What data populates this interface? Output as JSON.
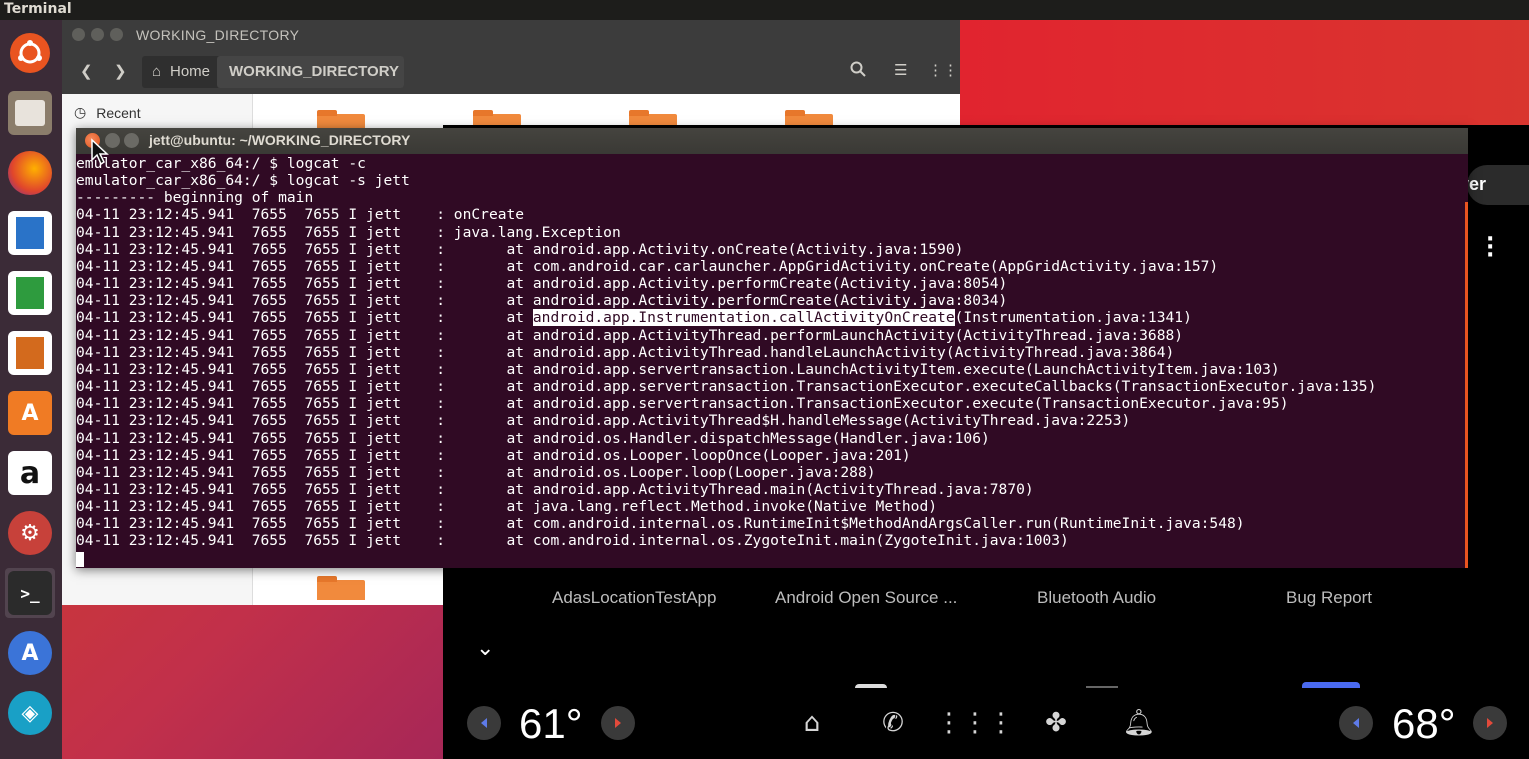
{
  "top_panel": {
    "app_name": "Terminal"
  },
  "launcher": {
    "items": [
      "ubuntu-dash",
      "files",
      "firefox",
      "libreoffice-writer",
      "libreoffice-calc",
      "libreoffice-impress",
      "ubuntu-software",
      "amazon",
      "system-settings",
      "terminal",
      "android-studio",
      "remote-app"
    ]
  },
  "nautilus": {
    "title": "WORKING_DIRECTORY",
    "path_home": "Home",
    "path_current": "WORKING_DIRECTORY",
    "sidebar_recent": "Recent"
  },
  "terminal": {
    "title": "jett@ubuntu: ~/WORKING_DIRECTORY",
    "prefix_lines": [
      "emulator_car_x86_64:/ $ logcat -c",
      "emulator_car_x86_64:/ $ logcat -s jett",
      "--------- beginning of main",
      "04-11 23:12:45.941  7655  7655 I jett    : onCreate",
      "04-11 23:12:45.941  7655  7655 I jett    : java.lang.Exception",
      "04-11 23:12:45.941  7655  7655 I jett    :       at android.app.Activity.onCreate(Activity.java:1590)",
      "04-11 23:12:45.941  7655  7655 I jett    :       at com.android.car.carlauncher.AppGridActivity.onCreate(AppGridActivity.java:157)",
      "04-11 23:12:45.941  7655  7655 I jett    :       at android.app.Activity.performCreate(Activity.java:8054)",
      "04-11 23:12:45.941  7655  7655 I jett    :       at android.app.Activity.performCreate(Activity.java:8034)"
    ],
    "hl_line_before": "04-11 23:12:45.941  7655  7655 I jett    :       at ",
    "hl_text": "android.app.Instrumentation.callActivityOnCreate",
    "hl_line_after": "(Instrumentation.java:1341)",
    "suffix_lines": [
      "04-11 23:12:45.941  7655  7655 I jett    :       at android.app.ActivityThread.performLaunchActivity(ActivityThread.java:3688)",
      "04-11 23:12:45.941  7655  7655 I jett    :       at android.app.ActivityThread.handleLaunchActivity(ActivityThread.java:3864)",
      "04-11 23:12:45.941  7655  7655 I jett    :       at android.app.servertransaction.LaunchActivityItem.execute(LaunchActivityItem.java:103)",
      "04-11 23:12:45.941  7655  7655 I jett    :       at android.app.servertransaction.TransactionExecutor.executeCallbacks(TransactionExecutor.java:135)",
      "04-11 23:12:45.941  7655  7655 I jett    :       at android.app.servertransaction.TransactionExecutor.execute(TransactionExecutor.java:95)",
      "04-11 23:12:45.941  7655  7655 I jett    :       at android.app.ActivityThread$H.handleMessage(ActivityThread.java:2253)",
      "04-11 23:12:45.941  7655  7655 I jett    :       at android.os.Handler.dispatchMessage(Handler.java:106)",
      "04-11 23:12:45.941  7655  7655 I jett    :       at android.os.Looper.loopOnce(Looper.java:201)",
      "04-11 23:12:45.941  7655  7655 I jett    :       at android.os.Looper.loop(Looper.java:288)",
      "04-11 23:12:45.941  7655  7655 I jett    :       at android.app.ActivityThread.main(ActivityThread.java:7870)",
      "04-11 23:12:45.941  7655  7655 I jett    :       at java.lang.reflect.Method.invoke(Native Method)",
      "04-11 23:12:45.941  7655  7655 I jett    :       at com.android.internal.os.RuntimeInit$MethodAndArgsCaller.run(RuntimeInit.java:548)",
      "04-11 23:12:45.941  7655  7655 I jett    :       at com.android.internal.os.ZygoteInit.main(ZygoteInit.java:1003)"
    ]
  },
  "emulator": {
    "partial_button": "ver",
    "apps": [
      "AdasLocationTestApp",
      "Android Open Source ...",
      "Bluetooth Audio",
      "Bug Report"
    ],
    "temp_left": "61°",
    "temp_right": "68°",
    "nav_icons": [
      "home-icon",
      "phone-icon",
      "app-grid-icon",
      "fan-icon",
      "bell-icon"
    ]
  }
}
